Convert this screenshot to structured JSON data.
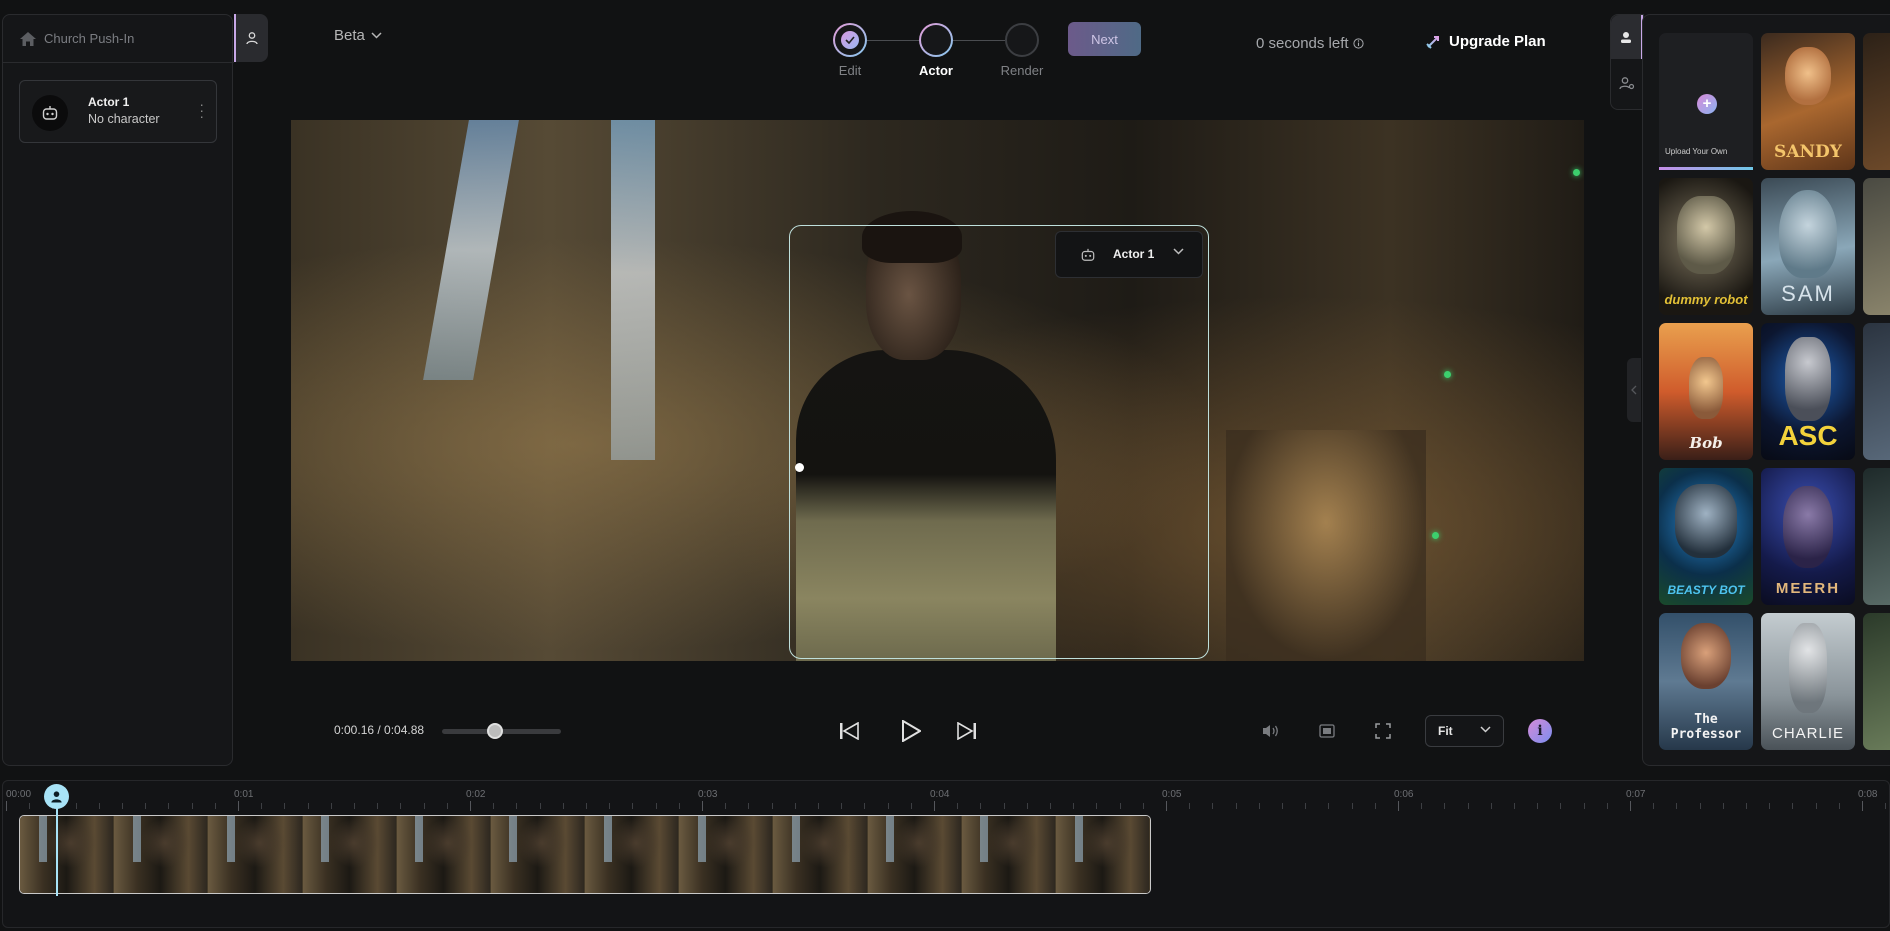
{
  "left_panel": {
    "project_name": "Church Push-In",
    "actor": {
      "name": "Actor 1",
      "character": "No character"
    }
  },
  "topbar": {
    "model_select": "Beta",
    "steps": [
      {
        "label": "Edit",
        "state": "done"
      },
      {
        "label": "Actor",
        "state": "active"
      },
      {
        "label": "Render",
        "state": "pending"
      }
    ],
    "next_label": "Next",
    "seconds_left": "0 seconds left",
    "upgrade_label": "Upgrade Plan"
  },
  "video": {
    "actor_chip_label": "Actor 1"
  },
  "controls": {
    "time_readout": "0:00.16 / 0:04.88",
    "fit_value": "Fit",
    "info_label": "i"
  },
  "right_panel": {
    "upload_caption": "Upload Your Own",
    "characters": [
      {
        "name": "SANDY",
        "color": "#e6a24e"
      },
      {
        "name": "dummy robot",
        "color": "#d9b23a"
      },
      {
        "name": "SAM",
        "color": "#7fa2b8"
      },
      {
        "name": "Bob",
        "color": "#e8704c"
      },
      {
        "name": "ASC",
        "color": "#1e6fd0"
      },
      {
        "name": "BEASTY BOT",
        "color": "#3a7fc4"
      },
      {
        "name": "MEERH",
        "color": "#2c3b8c"
      },
      {
        "name": "The Professor",
        "color": "#4a6b86"
      },
      {
        "name": "CHARLIE",
        "color": "#9aa6ab"
      }
    ]
  },
  "timeline": {
    "ruler": [
      "00:00",
      "0:01",
      "0:02",
      "0:03",
      "0:04",
      "0:05",
      "0:06",
      "0:07",
      "0:08"
    ],
    "playhead_seconds": 0.16,
    "duration_seconds": 4.88
  }
}
